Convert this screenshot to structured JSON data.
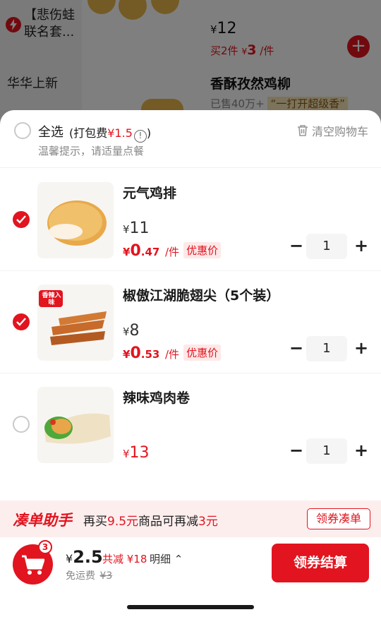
{
  "background": {
    "sidebar_promo": "【悲伤蛙联名套...",
    "sidebar_new": "华华上新",
    "price": "12",
    "promo_prefix": "买2件",
    "promo_price": "3",
    "promo_unit": "/件",
    "product_name": "香酥孜然鸡柳",
    "sold": "已售40万+",
    "slogan": "“一打开超级香”"
  },
  "header": {
    "select_all": "全选",
    "pack_fee_prefix": "(打包费",
    "pack_fee_value": "¥1.5",
    "pack_fee_suffix": ")",
    "tip": "温馨提示，请适量点餐",
    "clear_cart": "清空购物车"
  },
  "items": [
    {
      "name": "元气鸡排",
      "orig_price": "11",
      "discount_int": "0",
      "discount_dec": ".47",
      "discount_unit": "/件",
      "discount_tag": "优惠价",
      "qty": "1",
      "checked": true
    },
    {
      "name": "椒傲江湖脆翅尖（5个装）",
      "orig_price": "8",
      "discount_int": "0",
      "discount_dec": ".53",
      "discount_unit": "/件",
      "discount_tag": "优惠价",
      "qty": "1",
      "checked": true
    },
    {
      "name": "辣味鸡肉卷",
      "price": "13",
      "qty": "1",
      "checked": false
    }
  ],
  "currency": "¥",
  "item2_badge": "香辣入味",
  "helper": {
    "title": "凑单助手",
    "text_prefix": "再买",
    "amount": "9.5元",
    "text_mid": "商品可再减",
    "reduce": "3元",
    "button": "领券凑单"
  },
  "footer": {
    "cart_count": "3",
    "total": "2.5",
    "reduce_text": "共减 ¥18",
    "detail": "明细",
    "shipping_label": "免运费",
    "shipping_orig": "¥3",
    "checkout": "领券结算"
  },
  "colors": {
    "accent": "#e2141f",
    "discount_bg": "#fde8e8",
    "helper_bg": "#fdeeee"
  }
}
